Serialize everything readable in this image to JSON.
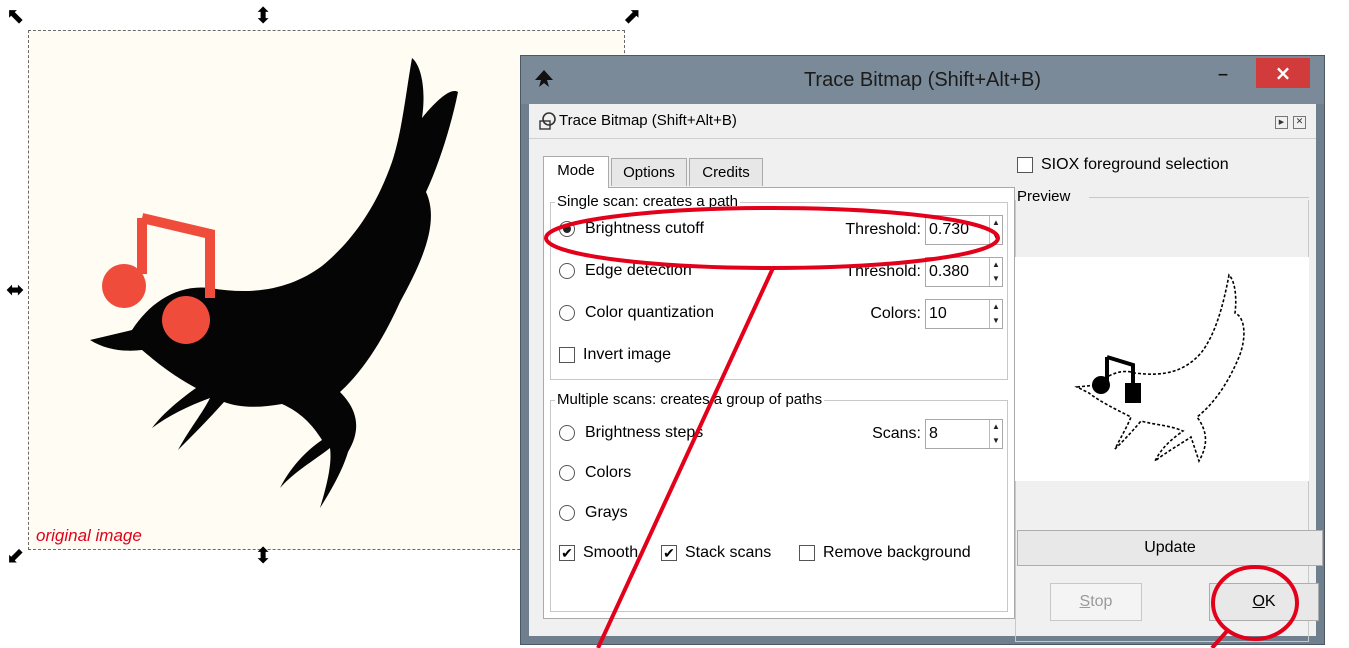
{
  "canvas": {
    "caption": "original image"
  },
  "window": {
    "title": "Trace Bitmap (Shift+Alt+B)",
    "minimize": "–",
    "close": "×"
  },
  "dock": {
    "title": "Trace Bitmap (Shift+Alt+B)"
  },
  "tabs": [
    {
      "label": "Mode",
      "active": true
    },
    {
      "label": "Options",
      "active": false
    },
    {
      "label": "Credits",
      "active": false
    }
  ],
  "single_scan": {
    "title": "Single scan: creates a path",
    "brightness_cutoff": {
      "label": "Brightness cutoff",
      "selected": true,
      "param_label": "Threshold:",
      "value": "0.730"
    },
    "edge_detection": {
      "label": "Edge detection",
      "selected": false,
      "param_label": "Threshold:",
      "value": "0.380"
    },
    "color_quantization": {
      "label": "Color quantization",
      "selected": false,
      "param_label": "Colors:",
      "value": "10"
    },
    "invert_image": {
      "label": "Invert image",
      "checked": false
    }
  },
  "multiple_scans": {
    "title": "Multiple scans: creates a group of paths",
    "brightness_steps": {
      "label": "Brightness steps",
      "selected": false,
      "param_label": "Scans:",
      "value": "8"
    },
    "colors": {
      "label": "Colors",
      "selected": false
    },
    "grays": {
      "label": "Grays",
      "selected": false
    },
    "smooth": {
      "label": "Smooth",
      "checked": true
    },
    "stack_scans": {
      "label": "Stack scans",
      "checked": true
    },
    "remove_background": {
      "label": "Remove background",
      "checked": false
    }
  },
  "siox": {
    "label": "SIOX foreground selection",
    "checked": false
  },
  "preview": {
    "title": "Preview"
  },
  "buttons": {
    "update": "Update",
    "stop_first": "S",
    "stop_rest": "top",
    "ok_first": "O",
    "ok_rest": "K"
  },
  "colors": {
    "annotation": "#e2001a",
    "titlebar": "#7a8a98",
    "close": "#d23b3b",
    "note": "#ef4c3b"
  },
  "icons": [
    "resize-handle-icon",
    "inkscape-icon",
    "trace-bitmap-icon",
    "pin-icon",
    "close-icon",
    "checkmark-icon"
  ]
}
